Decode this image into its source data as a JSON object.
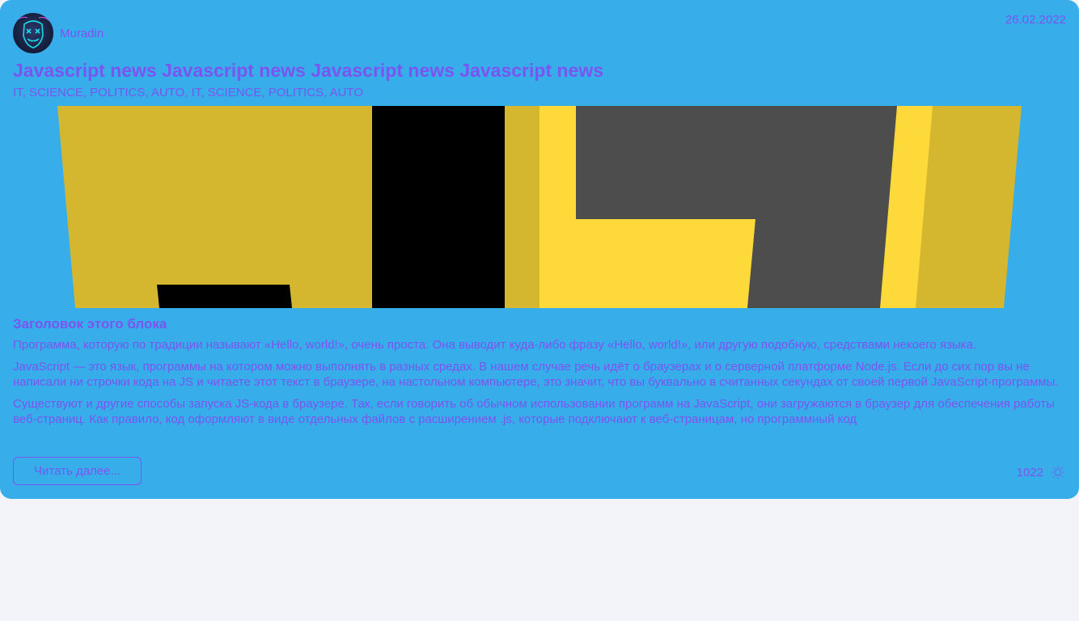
{
  "post": {
    "author": {
      "name": "Muradin",
      "avatar_icon": "neon-mask-avatar"
    },
    "date": "26.02.2022",
    "title": "Javascript news Javascript news Javascript news Javascript news",
    "tags": [
      "IT",
      "SCIENCE",
      "POLITICS",
      "AUTO",
      "IT",
      "SCIENCE",
      "POLITICS",
      "AUTO"
    ],
    "cover_image": {
      "icon": "javascript-logo-image",
      "colors": {
        "yellow_dark": "#d4b72e",
        "yellow_bright": "#fdd93a",
        "black": "#000000",
        "gray": "#4d4d4d"
      }
    },
    "block_title": "Заголовок этого блока",
    "paragraphs": [
      "Программа, которую по традиции называют «Hello, world!», очень проста. Она выводит куда-либо фразу «Hello, world!», или другую подобную, средствами некоего языка.",
      "JavaScript — это язык, программы на котором можно выполнять в разных средах. В нашем случае речь идёт о браузерах и о серверной платформе Node.js. Если до сих пор вы не написали ни строчки кода на JS и читаете этот текст в браузере, на настольном компьютере, это значит, что вы буквально в считанных секундах от своей первой JavaScript-программы.",
      "Существуют и другие способы запуска JS-кода в браузере. Так, если говорить об обычном использовании программ на JavaScript, они загружаются в браузер для обеспечения работы веб-страниц. Как правило, код оформляют в виде отдельных файлов с расширением .js, которые подключают к веб-страницам, но программный код"
    ],
    "read_more_label": "Читать далее...",
    "views": "1022",
    "views_icon": "eye-icon"
  },
  "colors": {
    "card_background": "#37adea",
    "accent": "#7a55f0",
    "page_background": "#f3f4f9"
  }
}
